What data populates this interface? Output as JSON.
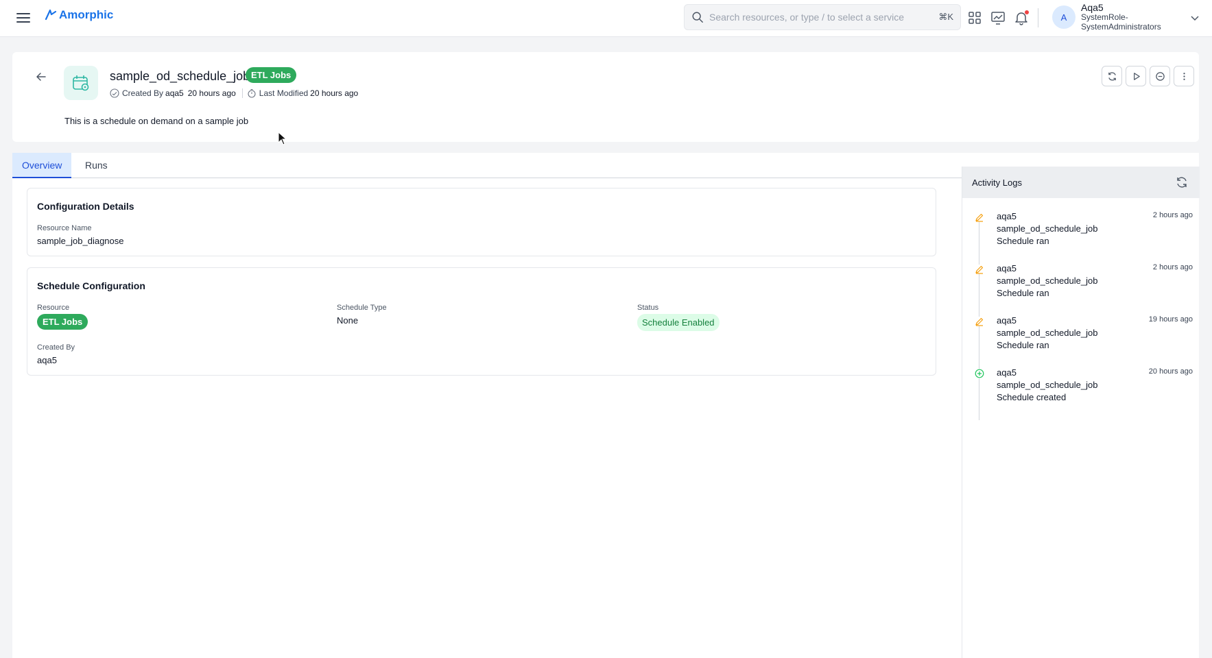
{
  "topbar": {
    "logo_text": "Amorphic",
    "search_placeholder": "Search resources, or type / to select a service",
    "search_shortcut": "⌘K",
    "user_initial": "A",
    "user_name": "Aqa5",
    "user_role": "SystemRole-SystemAdministrators",
    "colors": {
      "brand": "#1a73e8",
      "notification": "#ef4444"
    }
  },
  "header": {
    "title": "sample_od_schedule_job",
    "type_badge": "ETL Jobs",
    "created_by_label": "Created By",
    "created_by_user": "aqa5",
    "created_ago": "20 hours ago",
    "modified_label": "Last Modified",
    "modified_ago": "20 hours ago",
    "description": "This is a schedule on demand on a sample job",
    "actions": [
      "refresh-icon",
      "play-icon",
      "stop-icon",
      "more-icon"
    ]
  },
  "tabs": [
    {
      "label": "Overview",
      "active": true
    },
    {
      "label": "Runs",
      "active": false
    }
  ],
  "configuration": {
    "title": "Configuration Details",
    "resource_name_label": "Resource Name",
    "resource_name": "sample_job_diagnose"
  },
  "schedule": {
    "title": "Schedule Configuration",
    "resource_label": "Resource",
    "resource_value": "ETL Jobs",
    "schedule_type_label": "Schedule Type",
    "schedule_type_value": "None",
    "status_label": "Status",
    "status_value": "Schedule Enabled",
    "created_by_label": "Created By",
    "created_by_value": "aqa5"
  },
  "activity": {
    "title": "Activity Logs",
    "items": [
      {
        "icon": "pencil-icon",
        "user": "aqa5",
        "resource": "sample_od_schedule_job",
        "action": "Schedule ran",
        "time": "2 hours ago"
      },
      {
        "icon": "pencil-icon",
        "user": "aqa5",
        "resource": "sample_od_schedule_job",
        "action": "Schedule ran",
        "time": "2 hours ago"
      },
      {
        "icon": "pencil-icon",
        "user": "aqa5",
        "resource": "sample_od_schedule_job",
        "action": "Schedule ran",
        "time": "19 hours ago"
      },
      {
        "icon": "plus-circle-icon",
        "user": "aqa5",
        "resource": "sample_od_schedule_job",
        "action": "Schedule created",
        "time": "20 hours ago"
      }
    ]
  }
}
